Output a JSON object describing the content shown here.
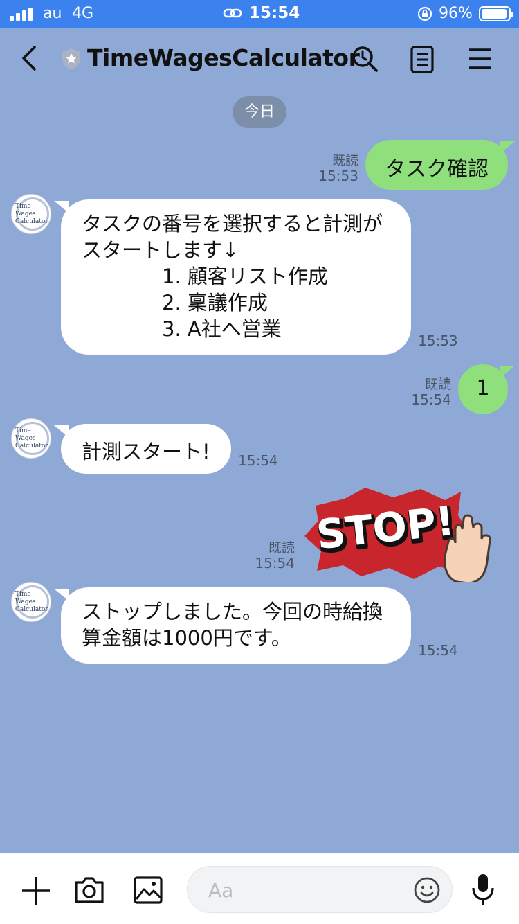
{
  "status": {
    "carrier": "au",
    "network": "4G",
    "time": "15:54",
    "battery": "96%"
  },
  "nav": {
    "title": "TimeWagesCalculator"
  },
  "date_separator": "今日",
  "avatar_lines": [
    "Time",
    "Wages",
    "Calculator"
  ],
  "messages": [
    {
      "side": "right",
      "lines": [
        "タスク確認"
      ],
      "read": "既読",
      "time": "15:53"
    },
    {
      "side": "left",
      "lines": [
        "タスクの番号を選択すると計測が",
        "スタートします↓",
        "1. 顧客リスト作成",
        "2. 稟議作成",
        "3. A社へ営業"
      ],
      "time": "15:53"
    },
    {
      "side": "right",
      "lines": [
        "1"
      ],
      "read": "既読",
      "time": "15:54"
    },
    {
      "side": "left",
      "lines": [
        "計測スタート!"
      ],
      "time": "15:54"
    },
    {
      "side": "right",
      "sticker": "STOP!",
      "read": "既読",
      "time": "15:54"
    },
    {
      "side": "left",
      "lines": [
        "ストップしました。今回の時給換",
        "算金額は1000円です。"
      ],
      "time": "15:54"
    }
  ],
  "input": {
    "placeholder": "Aa"
  },
  "colors": {
    "status_bar": "#3b82ef",
    "chat_background": "#8fa9d6",
    "outgoing_bubble": "#8fe07c",
    "incoming_bubble": "#ffffff"
  }
}
